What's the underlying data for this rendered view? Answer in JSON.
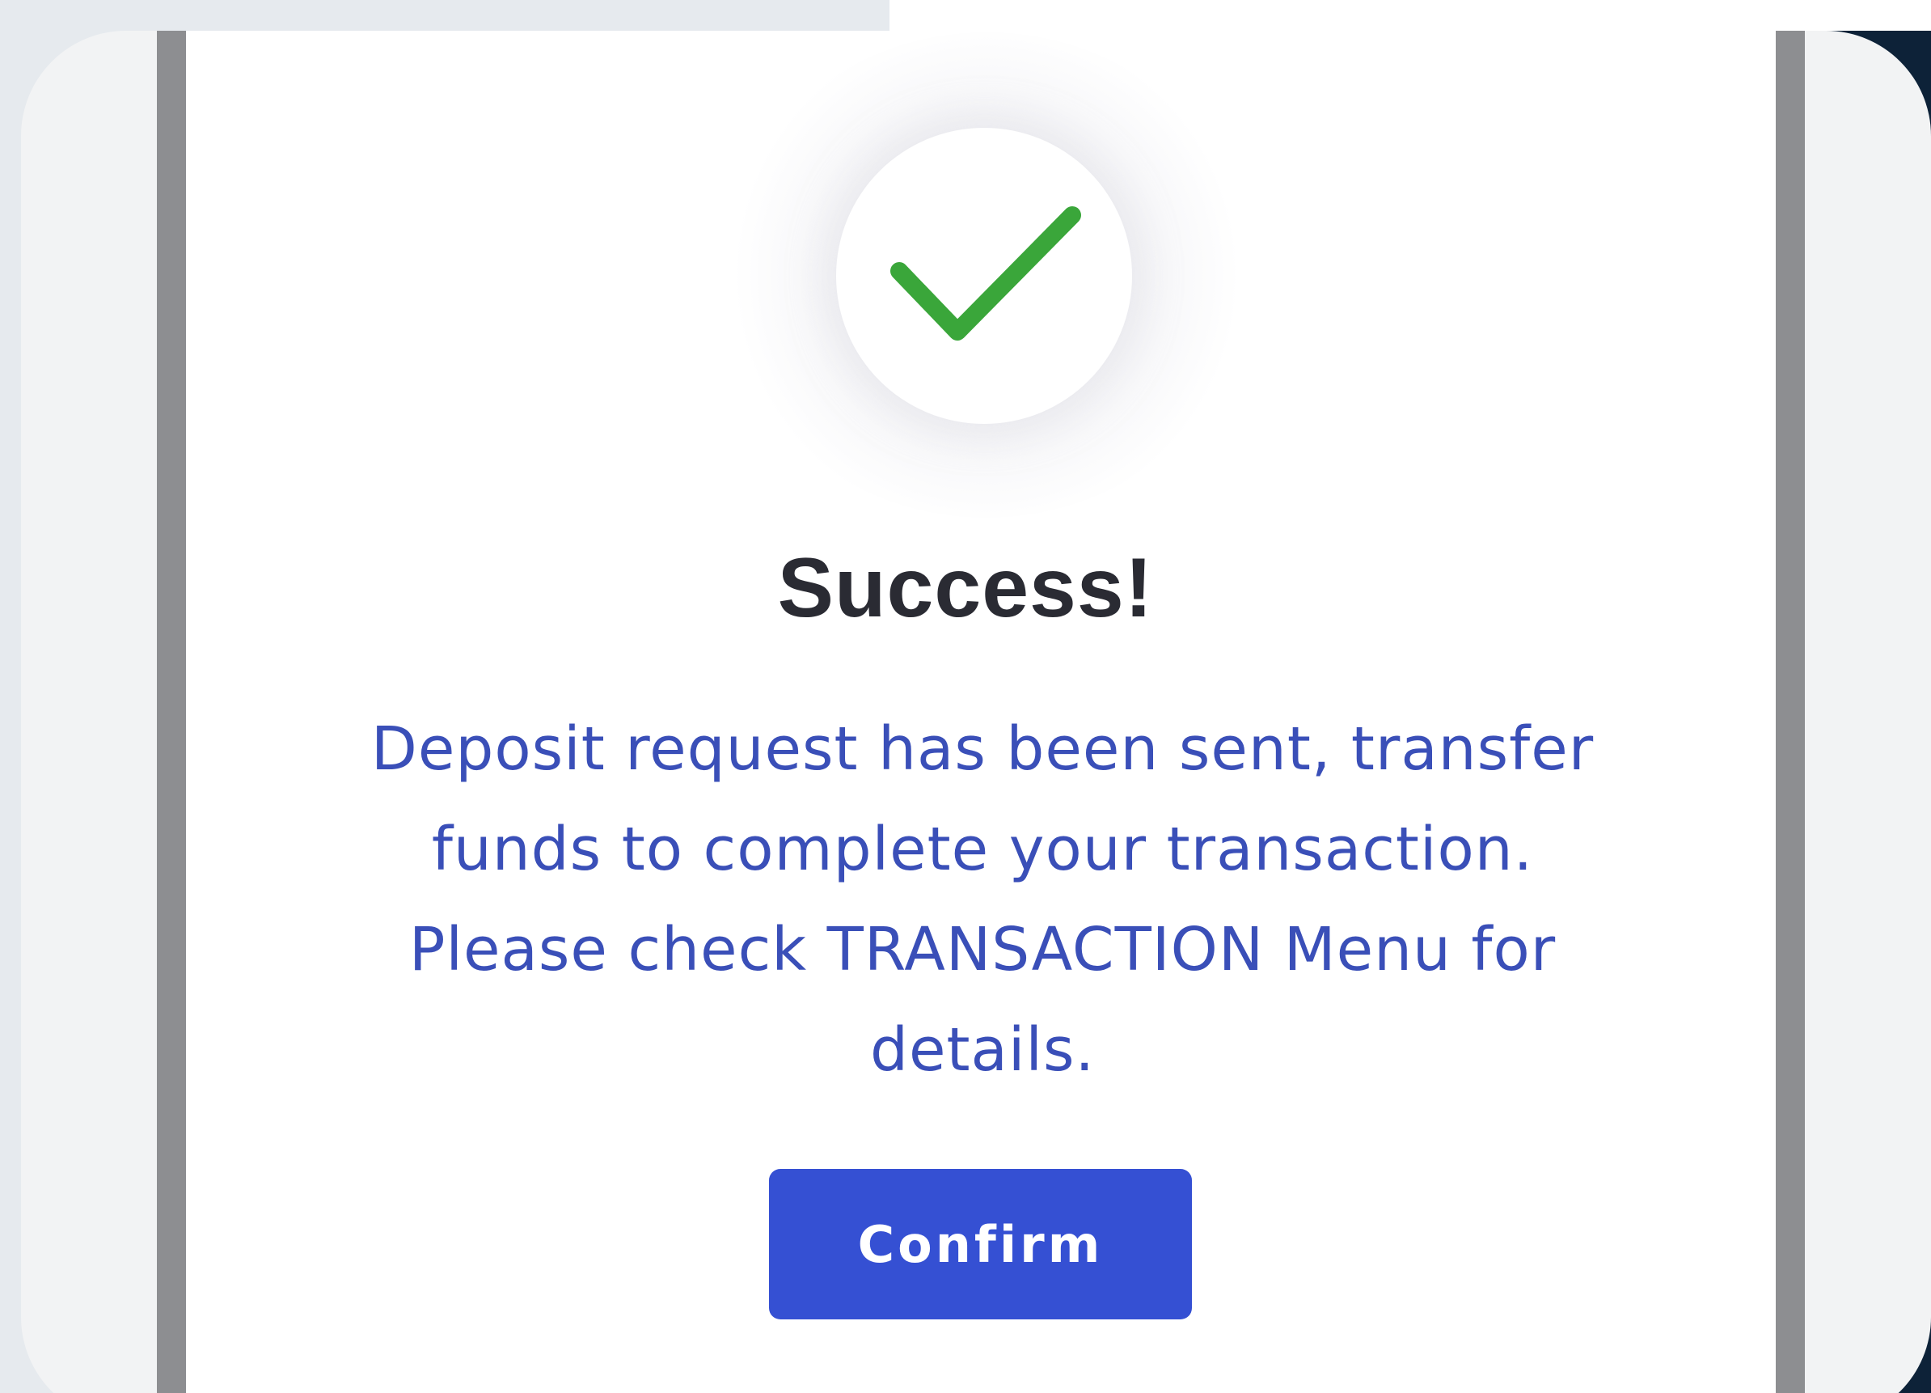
{
  "dialog": {
    "icon": "check-icon",
    "title": "Success!",
    "message_lines": [
      "Deposit request has been sent, transfer",
      "funds to complete your transaction.",
      "Please check TRANSACTION Menu for",
      "details."
    ],
    "confirm_label": "Confirm"
  },
  "colors": {
    "check": "#3aa63a",
    "title": "#2a2b33",
    "message": "#3a4fb8",
    "button": "#3550d3",
    "button_text": "#ffffff"
  }
}
